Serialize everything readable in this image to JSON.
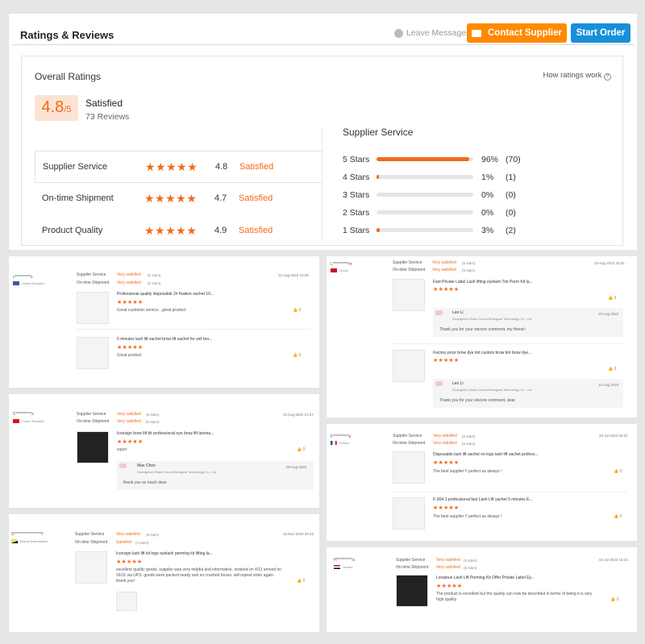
{
  "header": {
    "title": "Ratings & Reviews",
    "leave_messages": "Leave Messages",
    "contact_supplier": "Contact Supplier",
    "start_order": "Start Order"
  },
  "overall": {
    "title": "Overall Ratings",
    "how_ratings_work": "How ratings work",
    "score": "4.8",
    "score_max": "/5",
    "label": "Satisfied",
    "reviews": "73 Reviews",
    "metrics": [
      {
        "label": "Supplier Service",
        "score": "4.8",
        "text": "Satisfied",
        "rating": 4.8
      },
      {
        "label": "On-time Shipment",
        "score": "4.7",
        "text": "Satisfied",
        "rating": 4.7
      },
      {
        "label": "Product Quality",
        "score": "4.9",
        "text": "Satisfied",
        "rating": 4.9
      }
    ],
    "service_title": "Supplier Service",
    "distribution": [
      {
        "label": "5 Stars",
        "pct": "96%",
        "count": "(70)",
        "fraction": 0.96
      },
      {
        "label": "4 Stars",
        "pct": "1%",
        "count": "(1)",
        "fraction": 0.01
      },
      {
        "label": "3 Stars",
        "pct": "0%",
        "count": "(0)",
        "fraction": 0
      },
      {
        "label": "2 Stars",
        "pct": "0%",
        "count": "(0)",
        "fraction": 0
      },
      {
        "label": "1 Stars",
        "pct": "3%",
        "count": "(2)",
        "fraction": 0.03
      }
    ]
  },
  "reviews": {
    "r1": {
      "user": "c**********s",
      "country": "United Kingdom",
      "ss": "Supplier Service",
      "os": "On-time Shipment",
      "ss_text": "Very satisfied",
      "ss_stars": "(5 stars)",
      "os_text": "Very satisfied",
      "os_stars": "(5 stars)",
      "date": "12 Aug 2022 23:09",
      "p1_title": "Professional quality disposable 2# fixation sachet 10...",
      "p1_comment": "Great customer service , great product",
      "p1_likes": "0",
      "p2_title": "5 minutes lash lift sachet brow lift sachet for sell bro...",
      "p2_comment": "Great product",
      "p2_likes": "0"
    },
    "r2": {
      "user": "L**********m",
      "country": "Oman",
      "ss": "Supplier Service",
      "os": "On-time Shipment",
      "ss_text": "Very satisfied",
      "ss_stars": "(5 stars)",
      "os_text": "Very satisfied",
      "os_stars": "(5 stars)",
      "date": "10 Aug 2022 20:31",
      "p1_title": "Fast Private Label Lash lifting eyelash Tint Perm Kit la...",
      "p1_likes": "0",
      "reply_name": "Leo Li",
      "reply_co": "Guangzhou Stars Colors Biological Technology Co., Ltd",
      "reply_date": "10 Aug 2022",
      "reply_text": "Thank you for your sincere comment, my friend~",
      "p2_title": "Factory price brow dye tint custom brow tint brow dye...",
      "p2_likes": "0",
      "reply2_name": "Leo Li",
      "reply2_co": "Guangzhou Stars Colors Biological Technology Co., Ltd",
      "reply2_date": "10 Aug 2022",
      "reply2_text": "Thank you for your sincere comment, dear"
    },
    "r3": {
      "user": "C**********s",
      "country": "Czech Republic",
      "ss": "Supplier Service",
      "os": "On-time Shipment",
      "ss_text": "Very satisfied",
      "ss_stars": "(5 stars)",
      "os_text": "Very satisfied",
      "os_stars": "(5 stars)",
      "date": "19 Aug 2022 12:27",
      "p1_title": "Iconsign brow lift kit professional eye brow lift lamina...",
      "p1_comment": "super",
      "p1_likes": "0",
      "reply_name": "Max Chen",
      "reply_co": "Guangzhou Stars Colors Biological Technology Co., Ltd",
      "reply_date": "09 Aug 2022",
      "reply_text": "thank you so much dear"
    },
    "r4": {
      "user": "F**********e",
      "country": "France",
      "ss": "Supplier Service",
      "os": "On-time Shipment",
      "ss_text": "Very satisfied",
      "ss_stars": "(5 stars)",
      "os_text": "Very satisfied",
      "os_stars": "(5 stars)",
      "date": "28 Jul 2022 06:21",
      "p1_title": "Disposable lash lift sachet no logo lash lift sachet profess...",
      "p1_comment": "The best supplier !! perfect as always !",
      "p1_likes": "0",
      "p2_title": "F-004-1 professional fast Lash Lift sachet 5 minutes E...",
      "p2_comment": "The best supplier !! perfect as always !",
      "p2_likes": "0"
    },
    "r5": {
      "user": "S******************l",
      "country": "Brunei Darussalam",
      "ss": "Supplier Service",
      "os": "On-time Shipment",
      "ss_text": "Very satisfied",
      "ss_stars": "(5 stars)",
      "os_text": "Satisfied",
      "os_stars": "(4 stars)",
      "date": "18 Nov 2023 20:12",
      "p1_title": "Iconsign lash lift kit logo eyelash perming kit lifting la...",
      "p1_comment": "excellent quality goods, supplier was very helpful and informative. ordered on 4/11 arrived on 16/11 via UPS. goods were packed neatly and no crushed boxes. will repeat order again. thank you!",
      "p1_likes": "0"
    },
    "r6": {
      "user": "H**********a",
      "country": "Yemen",
      "ss": "Supplier Service",
      "os": "On-time Shipment",
      "ss_text": "Very satisfied",
      "ss_stars": "(5 stars)",
      "os_text": "Very satisfied",
      "os_stars": "(5 stars)",
      "date": "04 Jul 2022 15:24",
      "p1_title": "Lovatous Lash Lift Perming Kit Offer Private Label Ey...",
      "p1_comment": "The product is excellent but the quality can now be described in terms of being it is very high quality",
      "p1_likes": "0"
    }
  },
  "colors": {
    "accent": "#f26a1b",
    "contact": "#ff8a00",
    "start": "#1890d9"
  }
}
